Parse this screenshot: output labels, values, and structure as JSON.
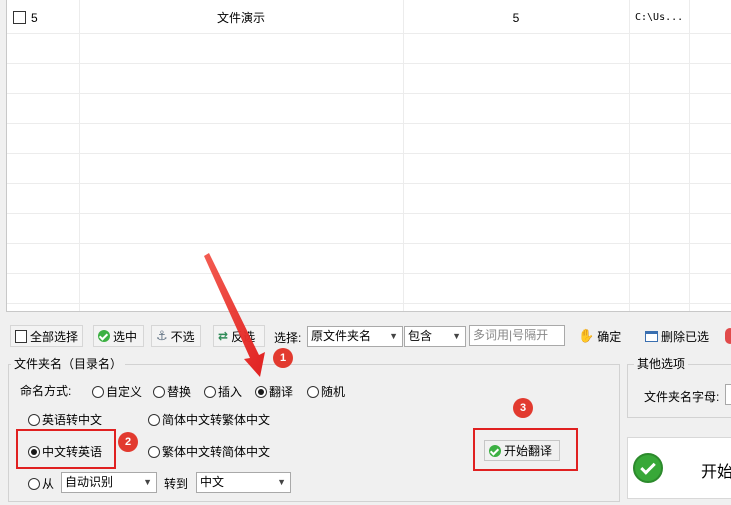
{
  "grid": {
    "row": {
      "index": "5",
      "name": "文件演示",
      "count": "5",
      "path": "C:\\Us..."
    }
  },
  "toolbar": {
    "select_all": "全部选择",
    "select": "选中",
    "deselect": "不选",
    "invert": "反选",
    "choose_label": "选择:",
    "choose_value": "原文件夹名",
    "match_value": "包含",
    "keyword_placeholder": "多词用|号隔开",
    "confirm": "确定",
    "delete_selected": "删除已选"
  },
  "folder_group": {
    "title": "文件夹名（目录名）",
    "naming_label": "命名方式:",
    "modes": [
      "自定义",
      "替换",
      "插入",
      "翻译",
      "随机"
    ],
    "selected_mode": "翻译",
    "translate_options": [
      "英语转中文",
      "简体中文转繁体中文",
      "中文转英语",
      "繁体中文转简体中文"
    ],
    "selected_translate": "中文转英语",
    "from_label": "从",
    "from_value": "自动识别",
    "to_label": "转到",
    "to_value": "中文",
    "start_button": "开始翻译"
  },
  "other_group": {
    "title": "其他选项",
    "letter_label": "文件夹名字母:"
  },
  "big_start": "开始",
  "annotations": [
    "1",
    "2",
    "3"
  ],
  "colors": {
    "highlight": "#e02020",
    "badge": "#e23a2f",
    "success": "#3cb043"
  }
}
